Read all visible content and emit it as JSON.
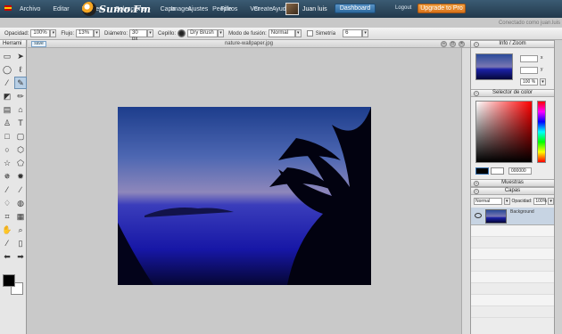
{
  "menubar": {
    "items": [
      "Archivo",
      "Editar",
      "Imagen",
      "Seleccionar",
      "Capa",
      "Ajustes",
      "Filtros",
      "Ver",
      "Ayuda"
    ]
  },
  "brand": {
    "name": "Sumo.Fm"
  },
  "nav": {
    "items": [
      "Images",
      "People",
      "Create"
    ]
  },
  "user": {
    "name": "Juan luis",
    "dashboard_label": "Dashboard",
    "logout_label": "Logout",
    "upgrade_label": "Upgrade to Pro",
    "connected_text": "Conectado como juan.luis"
  },
  "options": {
    "opacity_label": "Opacidad:",
    "opacity_value": "100%",
    "flow_label": "Flujo:",
    "flow_value": "13%",
    "diameter_label": "Diámetro:",
    "diameter_value": "30 px",
    "brush_label": "Cepillo:",
    "brush_value": "Dry Brush",
    "blend_label": "Modo de fusión:",
    "blend_value": "Normal",
    "symmetry_label": "Simetría",
    "symmetry_value": "6"
  },
  "toolbar": {
    "header": "Herrami"
  },
  "document": {
    "save_label": "save",
    "title": "nature-wallpaper.jpg"
  },
  "panels": {
    "info": {
      "title": "Info / Zoom",
      "x_label": "x",
      "y_label": "y",
      "zoom_value": "100 %"
    },
    "color": {
      "title": "Selector de color",
      "hex_value": "000000"
    },
    "swatches": {
      "title": "Muestras"
    },
    "layers": {
      "title": "Capas",
      "blend_value": "Normal",
      "opacity_label": "Opacidad:",
      "opacity_value": "100%",
      "layer_name": "Background"
    }
  },
  "colors": {
    "topbar": "#22394c",
    "accent": "#2d6aa0",
    "upgrade": "#d9731b"
  }
}
